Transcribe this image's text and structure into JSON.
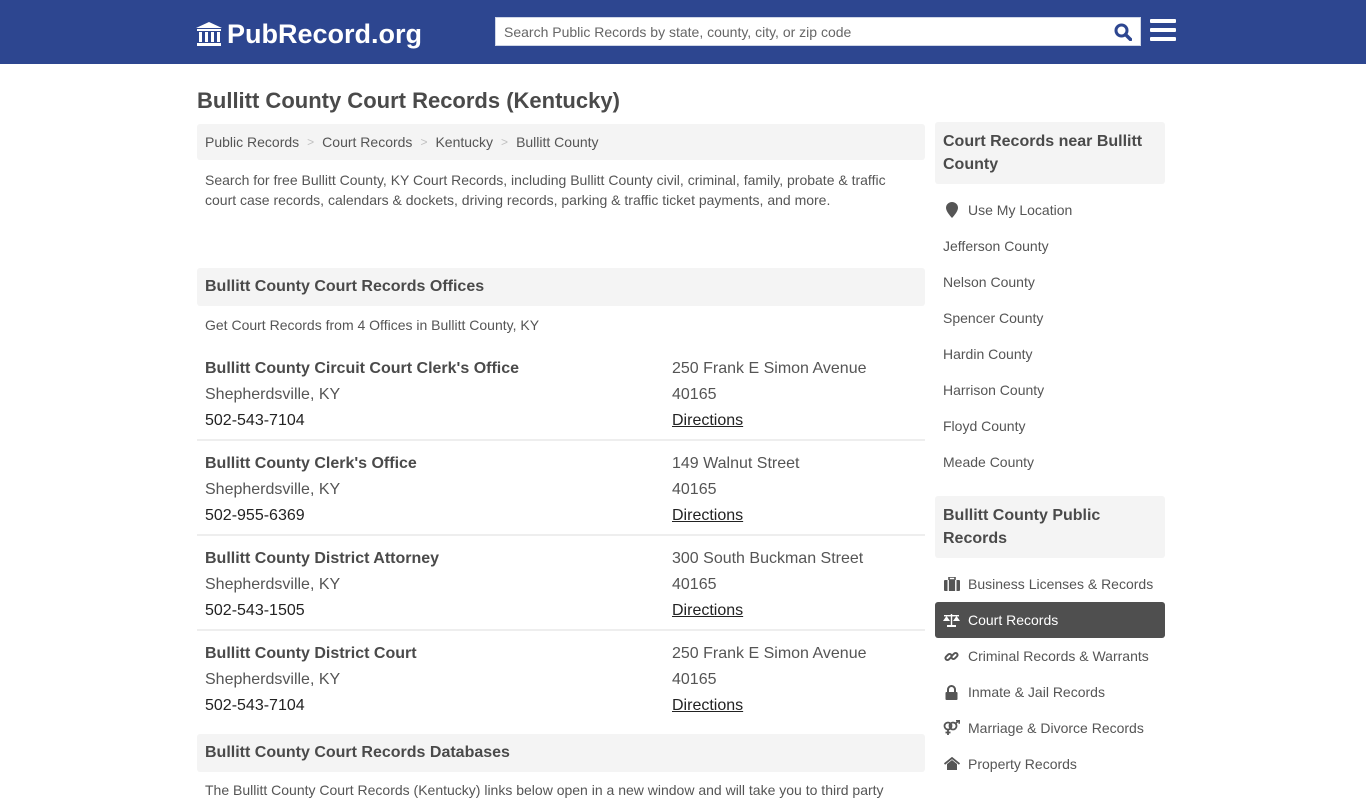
{
  "header": {
    "logo_text": "PubRecord.org",
    "search_placeholder": "Search Public Records by state, county, city, or zip code"
  },
  "page_title": "Bullitt County Court Records (Kentucky)",
  "breadcrumb": [
    "Public Records",
    "Court Records",
    "Kentucky",
    "Bullitt County"
  ],
  "intro": "Search for free Bullitt County, KY Court Records, including Bullitt County civil, criminal, family, probate & traffic court case records, calendars & dockets, driving records, parking & traffic ticket payments, and more.",
  "offices_section": {
    "heading": "Bullitt County Court Records Offices",
    "subtitle": "Get Court Records from 4 Offices in Bullitt County, KY",
    "directions_label": "Directions",
    "offices": [
      {
        "name": "Bullitt County Circuit Court Clerk's Office",
        "city": "Shepherdsville, KY",
        "phone": "502-543-7104",
        "address": "250 Frank E Simon Avenue",
        "zip": "40165"
      },
      {
        "name": "Bullitt County Clerk's Office",
        "city": "Shepherdsville, KY",
        "phone": "502-955-6369",
        "address": "149 Walnut Street",
        "zip": "40165"
      },
      {
        "name": "Bullitt County District Attorney",
        "city": "Shepherdsville, KY",
        "phone": "502-543-1505",
        "address": "300 South Buckman Street",
        "zip": "40165"
      },
      {
        "name": "Bullitt County District Court",
        "city": "Shepherdsville, KY",
        "phone": "502-543-7104",
        "address": "250 Frank E Simon Avenue",
        "zip": "40165"
      }
    ]
  },
  "databases_section": {
    "heading": "Bullitt County Court Records Databases",
    "text": "The Bullitt County Court Records (Kentucky) links below open in a new window and will take you to third party"
  },
  "sidebar": {
    "nearby_heading": "Court Records near Bullitt County",
    "use_location": "Use My Location",
    "nearby": [
      "Jefferson County",
      "Nelson County",
      "Spencer County",
      "Hardin County",
      "Harrison County",
      "Floyd County",
      "Meade County"
    ],
    "public_heading": "Bullitt County Public Records",
    "public_items": [
      {
        "label": "Business Licenses & Records",
        "icon": "briefcase-icon",
        "active": false
      },
      {
        "label": "Court Records",
        "icon": "balance-scale-icon",
        "active": true
      },
      {
        "label": "Criminal Records & Warrants",
        "icon": "link-icon",
        "active": false
      },
      {
        "label": "Inmate & Jail Records",
        "icon": "lock-icon",
        "active": false
      },
      {
        "label": "Marriage & Divorce Records",
        "icon": "venus-mars-icon",
        "active": false
      },
      {
        "label": "Property Records",
        "icon": "home-icon",
        "active": false
      }
    ]
  },
  "colors": {
    "header_bg": "#2d4690",
    "search_icon": "#2d4690",
    "active_item_bg": "#4f4f4f",
    "section_bg": "#f4f4f4"
  }
}
